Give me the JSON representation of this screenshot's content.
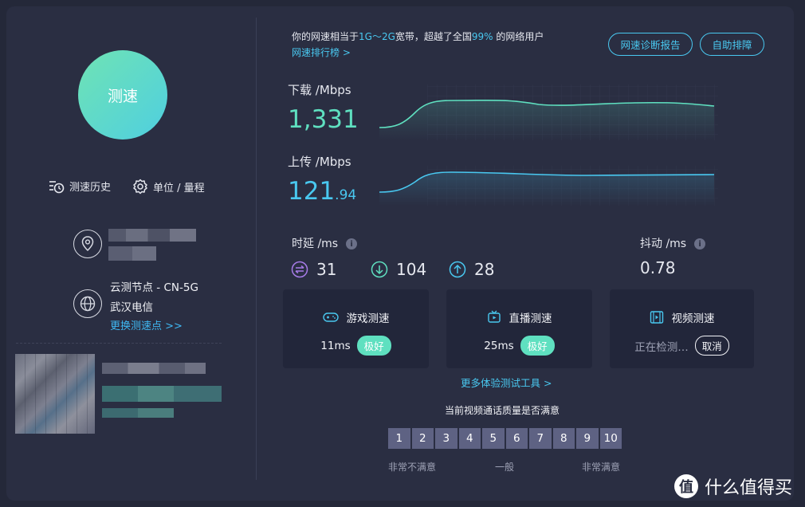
{
  "left": {
    "speed_button": "测速",
    "history_label": "测速历史",
    "unit_label": "单位 / 量程",
    "node_name": "云测节点 - CN-5G",
    "node_isp": "武汉电信",
    "node_change": "更换测速点 >>"
  },
  "summary": {
    "prefix": "你的网速相当于",
    "band": "1G～2G",
    "mid": "宽带，超越了全国",
    "percent": "99%",
    "suffix": "的网络用户",
    "rank_link": "网速排行榜 >"
  },
  "actions": {
    "diagnose": "网速诊断报告",
    "self_help": "自助排障"
  },
  "download": {
    "label": "下载 /Mbps",
    "value": "1,331",
    "color": "#5fe0c0"
  },
  "upload": {
    "label": "上传 /Mbps",
    "value_int": "121",
    "value_dec": ".94",
    "color": "#49c8f0"
  },
  "latency": {
    "label": "时延 /ms",
    "idle": "31",
    "down": "104",
    "up": "28"
  },
  "jitter": {
    "label": "抖动 /ms",
    "value": "0.78"
  },
  "cards": {
    "game": {
      "title": "游戏测速",
      "value": "11ms",
      "badge": "极好"
    },
    "live": {
      "title": "直播测速",
      "value": "25ms",
      "badge": "极好"
    },
    "video": {
      "title": "视频测速",
      "status": "正在检测…",
      "cancel": "取消"
    }
  },
  "more_tools": "更多体验测试工具 >",
  "quality": {
    "question": "当前视频通话质量是否满意",
    "scale": [
      "1",
      "2",
      "3",
      "4",
      "5",
      "6",
      "7",
      "8",
      "9",
      "10"
    ],
    "low": "非常不满意",
    "mid": "一般",
    "high": "非常满意"
  },
  "watermark": {
    "logo_char": "值",
    "text": "什么值得买"
  }
}
